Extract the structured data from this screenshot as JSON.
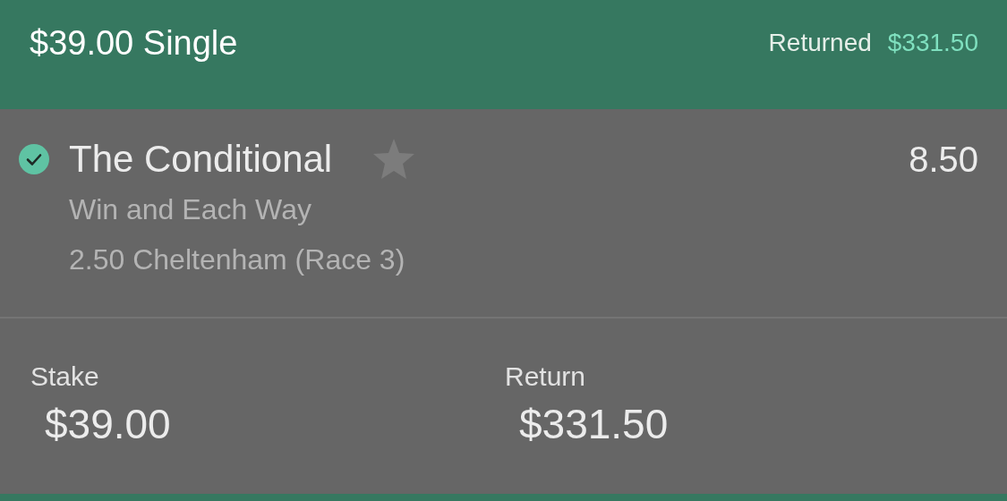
{
  "header": {
    "title": "$39.00 Single",
    "returned_label": "Returned",
    "returned_value": "$331.50"
  },
  "selection": {
    "name": "The Conditional",
    "won": true,
    "favourite": false,
    "odds": "8.50",
    "market": "Win and Each Way",
    "event": "2.50 Cheltenham (Race 3)"
  },
  "totals": [
    {
      "label": "Stake",
      "value": "$39.00"
    },
    {
      "label": "Return",
      "value": "$331.50"
    }
  ]
}
